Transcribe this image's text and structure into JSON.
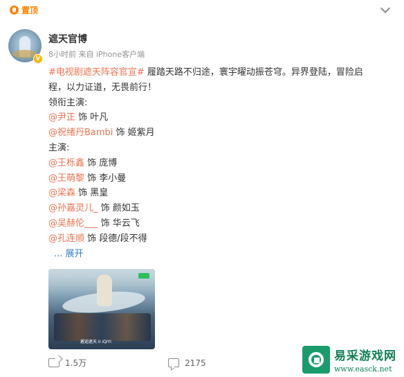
{
  "pinned": {
    "label": "置顶"
  },
  "author": {
    "name": "遮天官博",
    "meta": "8小时前 来自 iPhone客户端"
  },
  "post": {
    "hashtag": "#电视剧遮天阵容官宣#",
    "intro_line1": " 履踏天路不归途，寰宇曜动振苍穹。异界登陆，冒险启",
    "intro_line2": "程，以力证道，无畏前行！",
    "leading_cast_label": "领衔主演:",
    "leading_cast": [
      {
        "mention": "@尹正",
        "role": " 饰 叶凡"
      },
      {
        "mention": "@祝绪丹Bambi",
        "role": " 饰 姬紫月"
      }
    ],
    "cast_label": "主演:",
    "cast": [
      {
        "mention": "@王栎鑫",
        "role": " 饰 庞博"
      },
      {
        "mention": "@王萌黎",
        "role": " 饰 李小曼"
      },
      {
        "mention": "@梁森",
        "role": " 饰 黑皇"
      },
      {
        "mention": "@孙嘉灵儿_",
        "role": " 饰 颜如玉"
      },
      {
        "mention": "@吴赫伦___",
        "role": " 饰 华云飞"
      },
      {
        "mention": "@孔连顺",
        "role": " 饰 段德/段不得"
      }
    ],
    "expand_label": "... 展开",
    "media_caption": "邂逅遮天 ⅠⅠ iQIYI"
  },
  "actions": {
    "repost_count": "1.5万",
    "comment_count": "2175"
  },
  "watermark": {
    "title": "易采游戏网",
    "url": "www.easck.net"
  }
}
